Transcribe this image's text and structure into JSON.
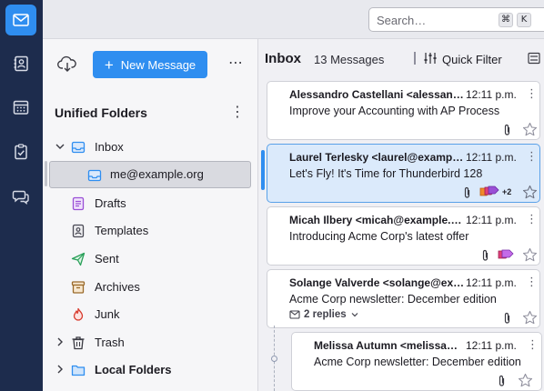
{
  "spaces": {
    "items": [
      {
        "icon": "mail-icon",
        "active": true
      },
      {
        "icon": "address-book-icon",
        "active": false
      },
      {
        "icon": "calendar-icon",
        "active": false
      },
      {
        "icon": "tasks-icon",
        "active": false
      },
      {
        "icon": "chat-icon",
        "active": false
      }
    ]
  },
  "search": {
    "placeholder": "Search…",
    "key1": "⌘",
    "key2": "K"
  },
  "folder_pane": {
    "new_message_label": "New Message",
    "more_label": "⋯",
    "title": "Unified Folders",
    "title_more": "⋮",
    "folders": [
      {
        "name": "Inbox",
        "icon": "inbox-icon"
      },
      {
        "name": "me@example.org",
        "icon": "inbox-icon"
      },
      {
        "name": "Drafts",
        "icon": "drafts-icon"
      },
      {
        "name": "Templates",
        "icon": "templates-icon"
      },
      {
        "name": "Sent",
        "icon": "sent-icon"
      },
      {
        "name": "Archives",
        "icon": "archive-icon"
      },
      {
        "name": "Junk",
        "icon": "junk-icon"
      },
      {
        "name": "Trash",
        "icon": "trash-icon"
      },
      {
        "name": "Local Folders",
        "icon": "folder-icon"
      }
    ]
  },
  "message_list": {
    "title": "Inbox",
    "count": "13 Messages",
    "quick_filter_label": "Quick Filter",
    "messages": [
      {
        "sender": "Alessandro Castellani <alessan…",
        "time": "12:11 p.m.",
        "subject": "Improve your Accounting with AP Process"
      },
      {
        "sender": "Laurel Terlesky <laurel@examp…",
        "time": "12:11 p.m.",
        "subject": "Let's Fly! It's Time for Thunderbird 128",
        "tag_extra": "+2"
      },
      {
        "sender": "Micah Ilbery <micah@example.…",
        "time": "12:11 p.m.",
        "subject": "Introducing Acme Corp's latest offer"
      },
      {
        "sender": "Solange Valverde <solange@ex…",
        "time": "12:11 p.m.",
        "subject": "Acme Corp newsletter: December edition",
        "replies": "2 replies"
      },
      {
        "sender": "Melissa Autumn <melissa…",
        "time": "12:11 p.m.",
        "subject": "Acme Corp newsletter: December edition"
      }
    ],
    "kebab": "⋮"
  },
  "colors": {
    "accent": "#2f8ef0",
    "spaces_bg": "#1d2c4d",
    "selected_card": "#dbeafb"
  }
}
